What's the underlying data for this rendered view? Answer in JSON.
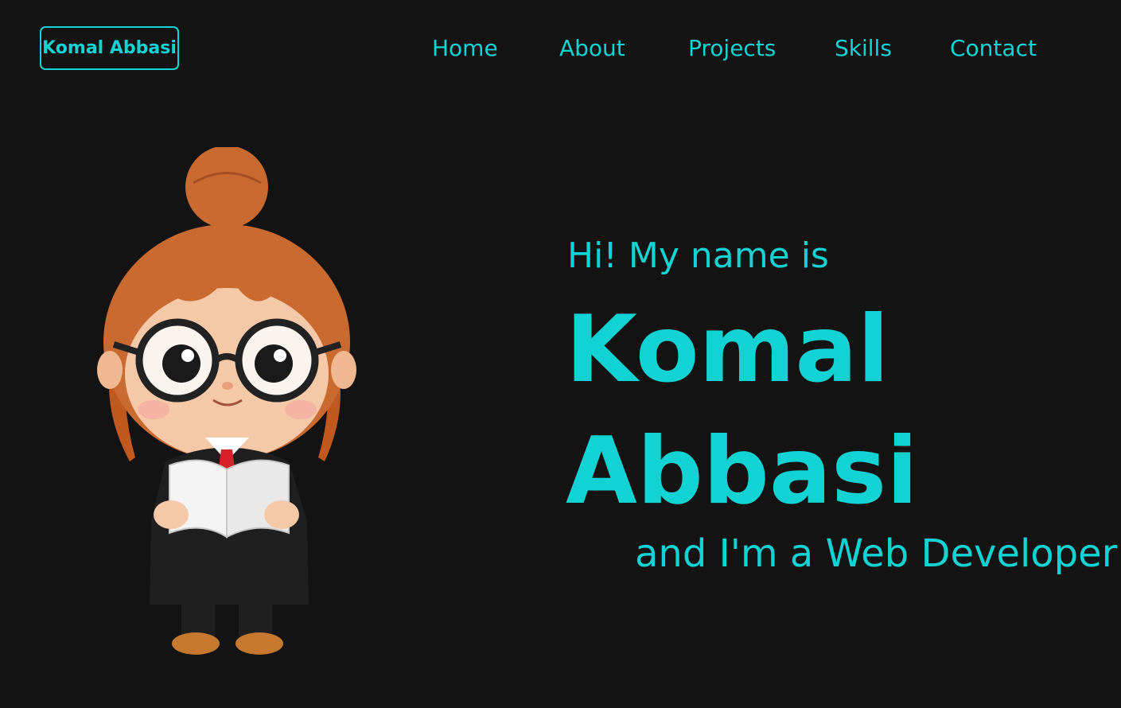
{
  "header": {
    "logo_label": "Komal Abbasi",
    "nav_items": [
      "Home",
      "About",
      "Projects",
      "Skills",
      "Contact"
    ]
  },
  "hero": {
    "intro": "Hi! My name is",
    "first_name": "Komal",
    "last_name": "Abbasi",
    "tagline": "and I'm a Web Developer!"
  },
  "colors": {
    "background": "#141314",
    "accent": "#12d3d3"
  },
  "icons": {
    "avatar": "cartoon-girl-reading-book-illustration"
  }
}
